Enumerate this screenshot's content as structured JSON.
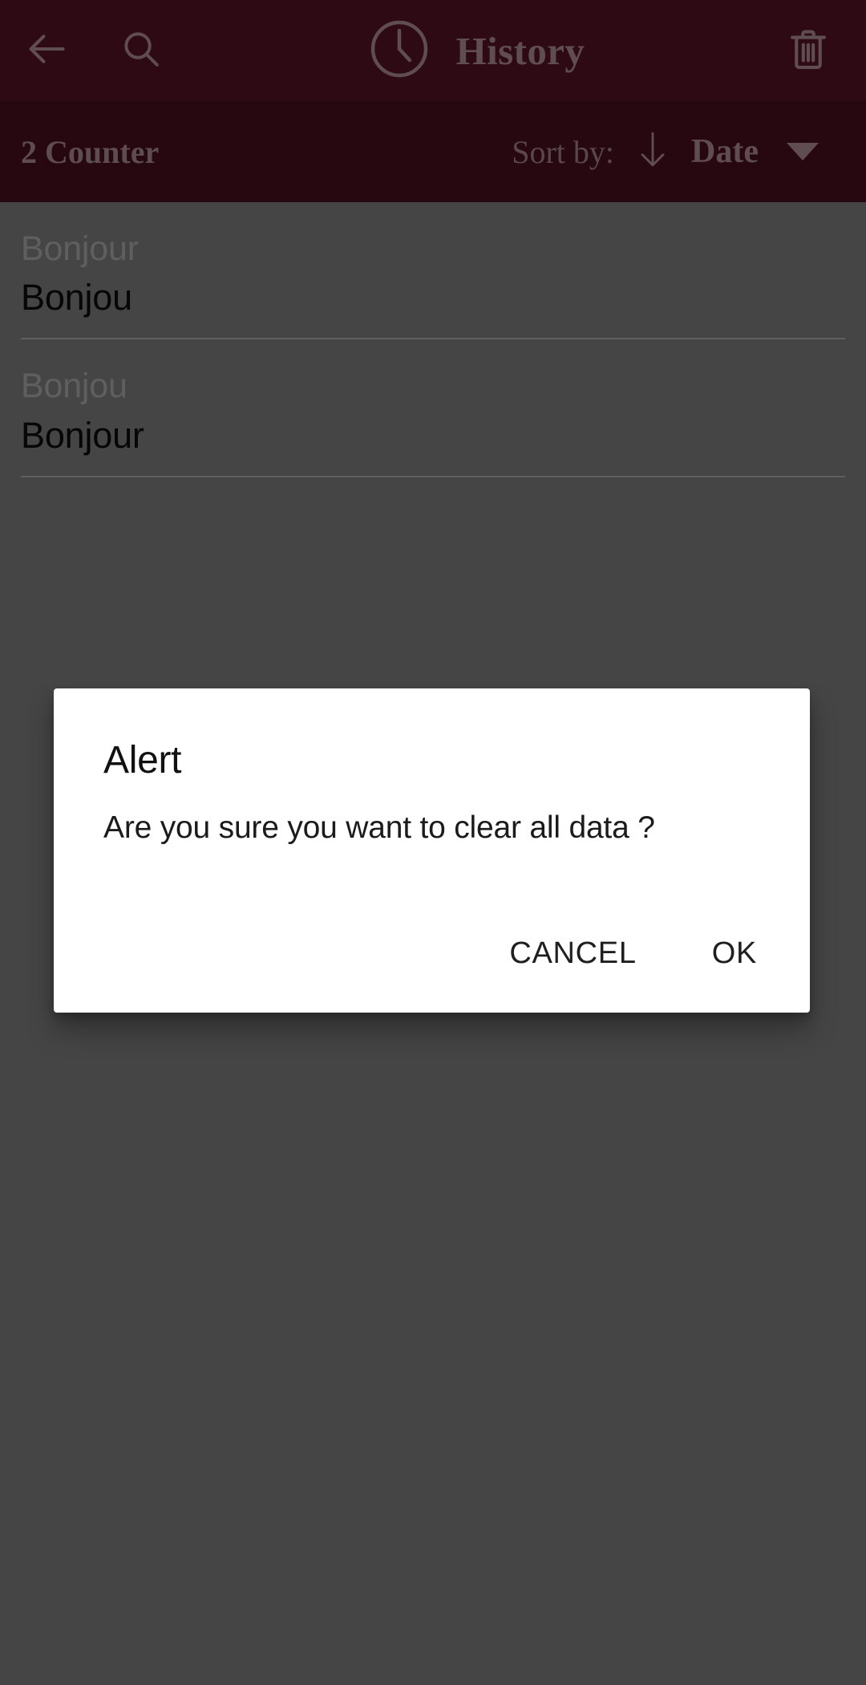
{
  "appbar": {
    "back_icon": "arrow-left-icon",
    "search_icon": "search-icon",
    "clock_icon": "clock-icon",
    "title": "History",
    "delete_icon": "trash-icon",
    "background_color": "#45101f",
    "foreground_color": "#8d7279"
  },
  "sortbar": {
    "counter_label": "2 Counter",
    "sort_by_label": "Sort by:",
    "sort_direction_icon": "arrow-down-icon",
    "sort_value": "Date",
    "dropdown_icon": "chevron-down-icon",
    "background_color": "#3a0b18"
  },
  "history": {
    "items": [
      {
        "sub": "Bonjour",
        "main": "Bonjou"
      },
      {
        "sub": "Bonjou",
        "main": "Bonjour"
      }
    ]
  },
  "dialog": {
    "title": "Alert",
    "message": "Are you sure you want to clear all data ?",
    "cancel_label": "CANCEL",
    "ok_label": "OK",
    "background_color": "#ffffff",
    "text_color": "#1f1f1f"
  },
  "scrim": {
    "color": "rgba(0,0,0,0.32)"
  }
}
